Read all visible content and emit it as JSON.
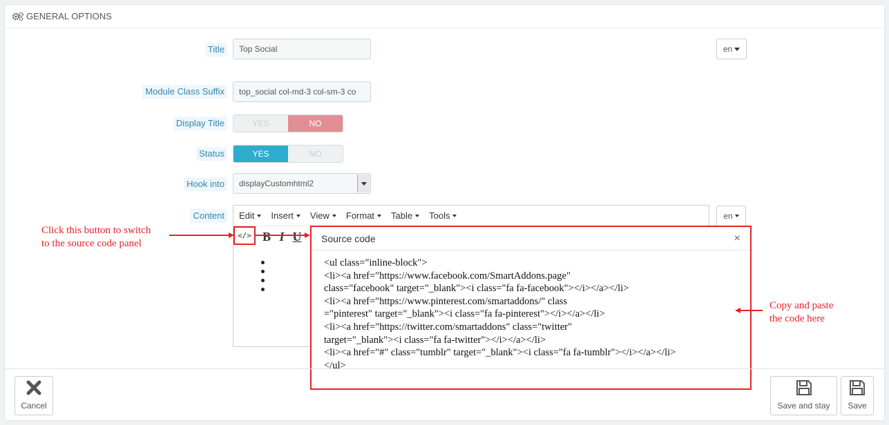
{
  "panel": {
    "heading": "GENERAL OPTIONS",
    "heading_icon": "cogs-icon"
  },
  "fields": {
    "title_label": "Title",
    "title_value": "Top Social",
    "lang_label": "en",
    "suffix_label": "Module Class Suffix",
    "suffix_value": "top_social col-md-3 col-sm-3 co",
    "display_title_label": "Display Title",
    "display_title_yes": "YES",
    "display_title_no": "NO",
    "display_title_value": "NO",
    "status_label": "Status",
    "status_yes": "YES",
    "status_no": "NO",
    "status_value": "YES",
    "hook_label": "Hook into",
    "hook_value": "displayCustomhtml2",
    "content_label": "Content",
    "content_lang": "en"
  },
  "editor": {
    "menu": [
      "Edit",
      "Insert",
      "View",
      "Format",
      "Table",
      "Tools"
    ],
    "toolbar": {
      "source": "</>",
      "bold": "B",
      "italic": "I",
      "underline": "U"
    }
  },
  "modal": {
    "title": "Source code",
    "close": "×",
    "code_lines": [
      "<ul class=\"inline-block\">",
      "<li><a href=\"https://www.facebook.com/SmartAddons.page\"",
      "class=\"facebook\" target=\"_blank\"><i class=\"fa fa-facebook\"></i></a></li>",
      "<li><a href=\"https://www.pinterest.com/smartaddons/\" class",
      "=\"pinterest\" target=\"_blank\"><i class=\"fa fa-pinterest\"></i></a></li>",
      "<li><a href=\"https://twitter.com/smartaddons\" class=\"twitter\"",
      "target=\"_blank\"><i class=\"fa fa-twitter\"></i></a></li>",
      "<li><a href=\"#\" class=\"tumblr\" target=\"_blank\"><i class=\"fa fa-tumblr\"></i></a></li>",
      "</ul>"
    ]
  },
  "annotations": {
    "switch_note_line1": "Click this button to switch",
    "switch_note_line2": "to the source code panel",
    "paste_note_line1": "Copy and paste",
    "paste_note_line2": "the code here"
  },
  "footer": {
    "cancel": "Cancel",
    "save_and_stay": "Save and stay",
    "save": "Save"
  },
  "colors": {
    "label_text": "#3586ae",
    "label_bg": "#eef7fb",
    "switch_yes": "#2eacce",
    "switch_no": "#e08f95",
    "annotation": "#e52228"
  }
}
